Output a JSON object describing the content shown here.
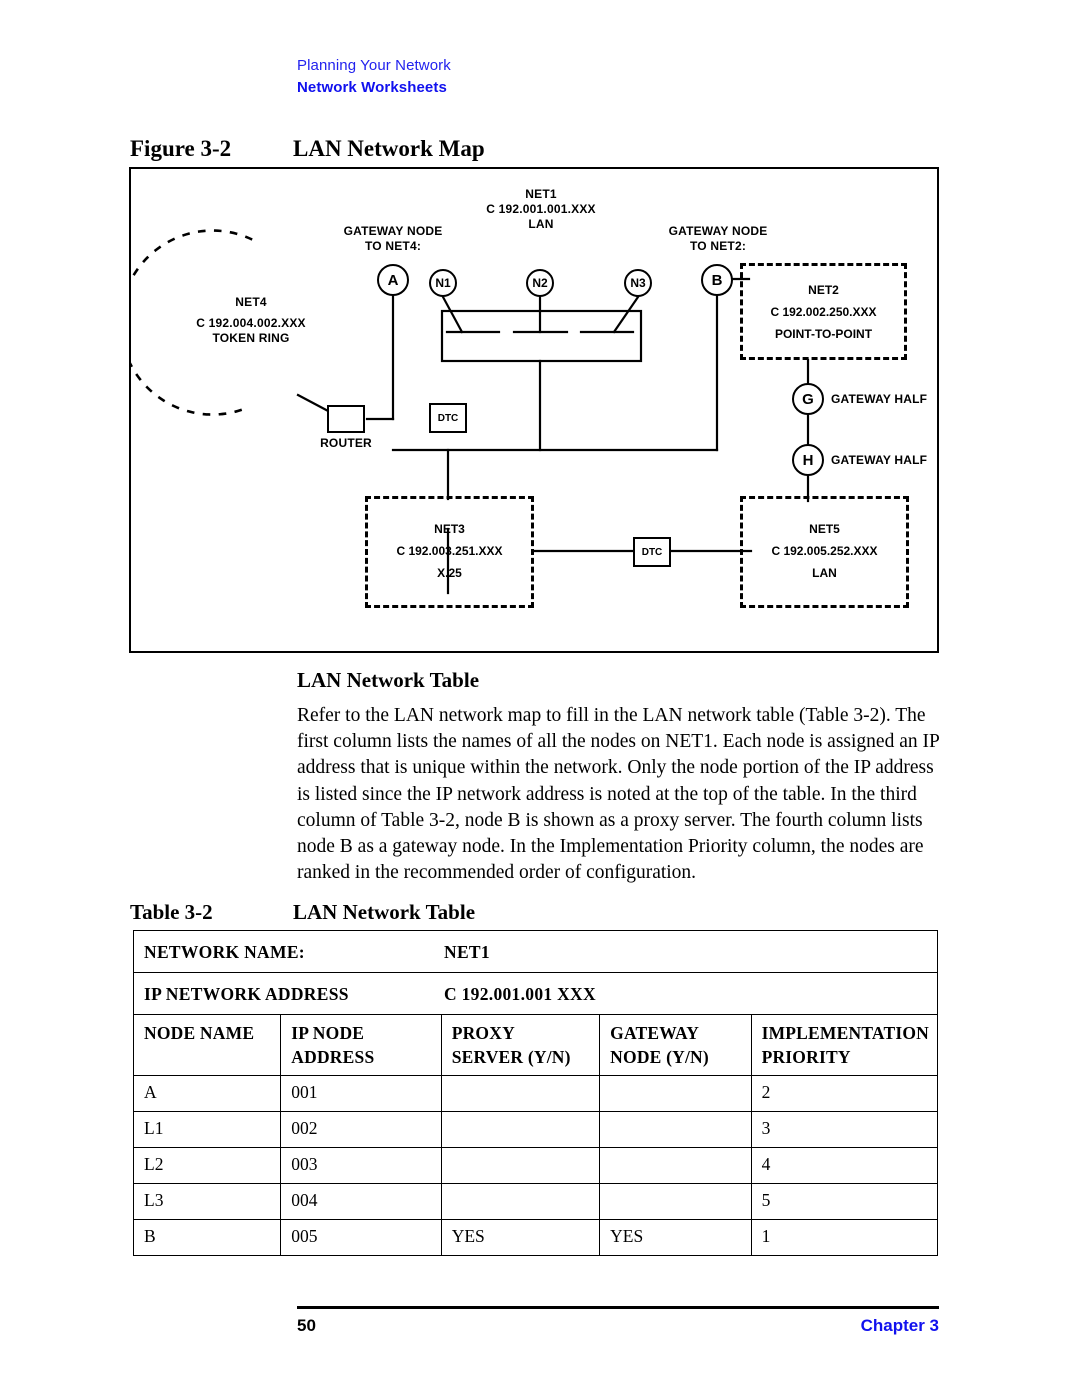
{
  "running_header": {
    "line1": "Planning Your Network",
    "line2": "Network Worksheets",
    "color_line1": "#2222ee",
    "color_line2": "#1111ee"
  },
  "figure": {
    "number": "Figure 3-2",
    "title": "LAN Network Map",
    "diagram": {
      "net1": {
        "name": "NET1",
        "address": "C 192.001.001.XXX",
        "type": "LAN"
      },
      "net2": {
        "name": "NET2",
        "address": "C 192.002.250.XXX",
        "type": "POINT-TO-POINT"
      },
      "net3": {
        "name": "NET3",
        "address": "C 192.003.251.XXX",
        "type": "X.25"
      },
      "net4": {
        "name": "NET4",
        "address": "C 192.004.002.XXX",
        "type": "TOKEN RING"
      },
      "net5": {
        "name": "NET5",
        "address": "C 192.005.252.XXX",
        "type": "LAN"
      },
      "gateway_to_net4_line1": "GATEWAY NODE",
      "gateway_to_net4_line2": "TO NET4:",
      "gateway_to_net2_line1": "GATEWAY NODE",
      "gateway_to_net2_line2": "TO NET2:",
      "node_a": "A",
      "node_b": "B",
      "node_n1": "N1",
      "node_n2": "N2",
      "node_n3": "N3",
      "node_g": "G",
      "node_h": "H",
      "gateway_half_g": "GATEWAY HALF",
      "gateway_half_h": "GATEWAY HALF",
      "router": "ROUTER",
      "dtc_upper": "DTC",
      "dtc_lower": "DTC"
    }
  },
  "section": {
    "heading": "LAN Network Table",
    "paragraph": "Refer to the LAN network map to fill in the LAN network table (Table 3-2). The first column lists the names of all the nodes on NET1. Each node is assigned an IP address that is unique within the network. Only the node portion of the IP address is listed since the IP network address is noted at the top of the table. In the third column of Table 3-2, node B is shown as a proxy server. The fourth column lists node B as a gateway node. In the Implementation Priority column, the nodes are ranked in the recommended order of configuration."
  },
  "table": {
    "number": "Table 3-2",
    "title": "LAN Network Table",
    "meta": [
      {
        "label": "NETWORK NAME:",
        "value": "NET1"
      },
      {
        "label": "IP NETWORK ADDRESS",
        "value": "C 192.001.001 XXX"
      }
    ],
    "columns": [
      {
        "line1": "NODE NAME",
        "line2": ""
      },
      {
        "line1": "IP NODE",
        "line2": "ADDRESS"
      },
      {
        "line1": "PROXY",
        "line2": "SERVER (Y/N)"
      },
      {
        "line1": "GATEWAY",
        "line2": "NODE (Y/N)"
      },
      {
        "line1": "IMPLEMENTATION",
        "line2": "PRIORITY"
      }
    ],
    "rows": [
      {
        "node_name": "A",
        "ip_node_address": "001",
        "proxy_server": "",
        "gateway_node": "",
        "implementation_priority": "2"
      },
      {
        "node_name": "L1",
        "ip_node_address": "002",
        "proxy_server": "",
        "gateway_node": "",
        "implementation_priority": "3"
      },
      {
        "node_name": "L2",
        "ip_node_address": "003",
        "proxy_server": "",
        "gateway_node": "",
        "implementation_priority": "4"
      },
      {
        "node_name": "L3",
        "ip_node_address": "004",
        "proxy_server": "",
        "gateway_node": "",
        "implementation_priority": "5"
      },
      {
        "node_name": "B",
        "ip_node_address": "005",
        "proxy_server": "YES",
        "gateway_node": "YES",
        "implementation_priority": "1"
      }
    ]
  },
  "footer": {
    "page_number": "50",
    "chapter": "Chapter 3",
    "chapter_color": "#1111ee"
  }
}
